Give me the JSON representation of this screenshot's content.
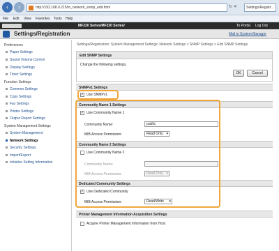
{
  "browser": {
    "url": "http://192.168.0.215/m_network_snmp_edit.html",
    "tab_title": "Settings/Registr...",
    "menu": [
      "File",
      "Edit",
      "View",
      "Favorites",
      "Tools",
      "Help"
    ]
  },
  "header": {
    "device": "MF220 Series/MF220 Series/",
    "to_portal": "To Portal",
    "log_out": "Log Out"
  },
  "title": {
    "page_title": "Settings/Registration",
    "mail_link": "Mail to System Manager"
  },
  "sidebar": {
    "preferences": {
      "heading": "Preferences",
      "items": [
        "Paper Settings",
        "Sound Volume Control",
        "Display Settings",
        "Timer Settings"
      ]
    },
    "function": {
      "heading": "Function Settings",
      "items": [
        "Common Settings",
        "Copy Settings",
        "Fax Settings",
        "Printer Settings",
        "Output Report Settings"
      ]
    },
    "management": {
      "heading": "System Management Settings",
      "items": [
        "System Management",
        "Network Settings",
        "Security Settings",
        "Import/Export",
        "Initialize Setting Information"
      ],
      "active": "Network Settings"
    }
  },
  "main": {
    "breadcrumb": "Settings/Registration: System Management Settings: Network Settings > SNMP Settings > Edit SNMP Settings",
    "edit_panel": {
      "heading": "Edit SNMP Settings",
      "description": "Change the following settings.",
      "ok": "OK",
      "cancel": "Cancel"
    },
    "snmpv1": {
      "heading": "SNMPv1 Settings",
      "use_label": "Use SNMPv1"
    },
    "community1": {
      "heading": "Community Name 1 Settings",
      "use_label": "Use Community Name 1",
      "name_label": "Community Name:",
      "name_value": "public",
      "mib_label": "MIB Access Permission:",
      "mib_value": "Read Only"
    },
    "community2": {
      "heading": "Community Name 2 Settings",
      "use_label": "Use Community Name 2",
      "name_label": "Community Name:",
      "name_value": "",
      "mib_label": "MIB Access Permission:",
      "mib_value": "Read Only"
    },
    "dedicated": {
      "heading": "Dedicated Community Settings",
      "use_label": "Use Dedicated Community",
      "mib_label": "MIB Access Permission:",
      "mib_value": "Read/Write"
    },
    "printer_mgmt": {
      "heading": "Printer Management Information Acquisition Settings",
      "label": "Acquire Printer Management Information from Host"
    }
  },
  "colors": {
    "highlight": "#f0a63a",
    "accent": "#1f5aa3"
  }
}
